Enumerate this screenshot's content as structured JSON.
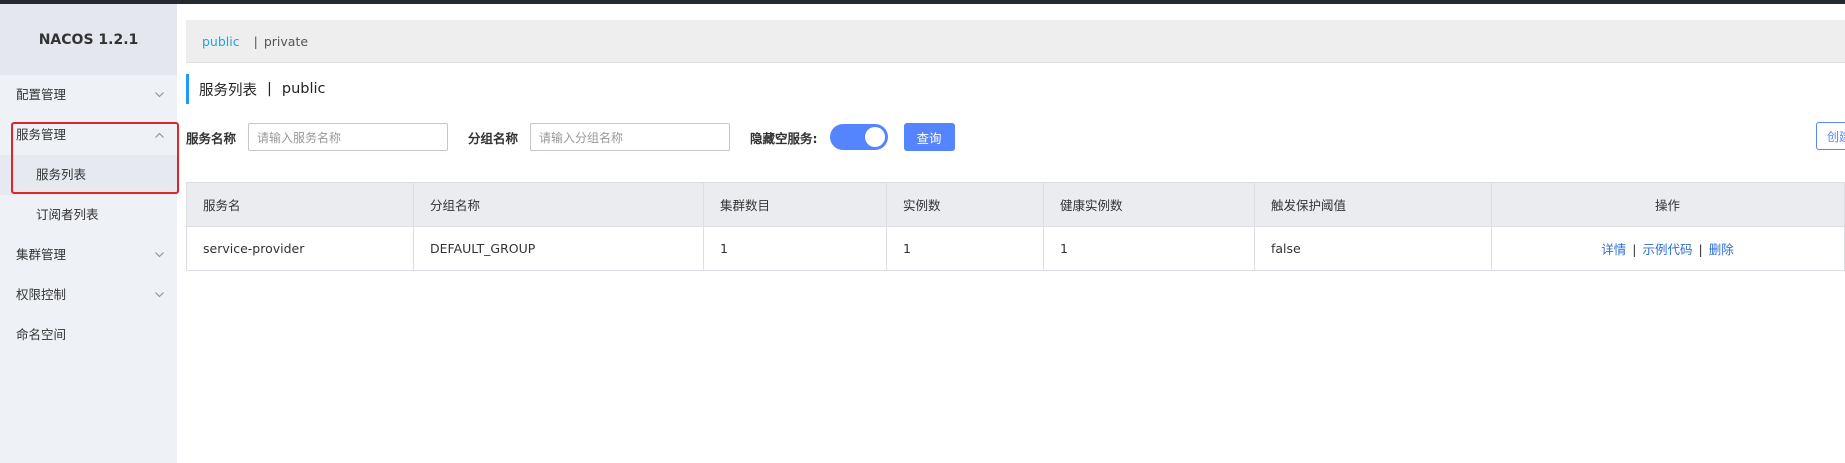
{
  "app": {
    "logo": "NACOS 1.2.1"
  },
  "sidebar": {
    "items": [
      {
        "label": "配置管理",
        "expanded": false,
        "has_children": true
      },
      {
        "label": "服务管理",
        "expanded": true,
        "has_children": true
      },
      {
        "label": "服务列表",
        "sub": true,
        "active": true
      },
      {
        "label": "订阅者列表",
        "sub": true
      },
      {
        "label": "集群管理",
        "expanded": false,
        "has_children": true
      },
      {
        "label": "权限控制",
        "expanded": false,
        "has_children": true
      },
      {
        "label": "命名空间",
        "has_children": false
      }
    ],
    "highlight_color": "#e0242c"
  },
  "namespaces": {
    "active": "public",
    "separator": "|",
    "other": "private"
  },
  "page": {
    "title": "服务列表",
    "divider": "|",
    "namespace": "public"
  },
  "filters": {
    "service_name_label": "服务名称",
    "service_name_placeholder": "请输入服务名称",
    "group_name_label": "分组名称",
    "group_name_placeholder": "请输入分组名称",
    "hide_empty_label": "隐藏空服务:",
    "hide_empty_on": true,
    "query_button": "查询",
    "create_button": "创建服务"
  },
  "table": {
    "columns": [
      "服务名",
      "分组名称",
      "集群数目",
      "实例数",
      "健康实例数",
      "触发保护阈值",
      "操作"
    ],
    "rows": [
      {
        "service_name": "service-provider",
        "group_name": "DEFAULT_GROUP",
        "cluster_count": "1",
        "instance_count": "1",
        "healthy_instance_count": "1",
        "protect_threshold": "false",
        "actions": {
          "detail": "详情",
          "sep": "|",
          "sample_code": "示例代码",
          "delete": "删除"
        }
      }
    ]
  },
  "colors": {
    "primary": "#5584ff",
    "link": "#2b6fd6",
    "namespace_link": "#1fa6d6",
    "title_accent": "#209bfa"
  }
}
